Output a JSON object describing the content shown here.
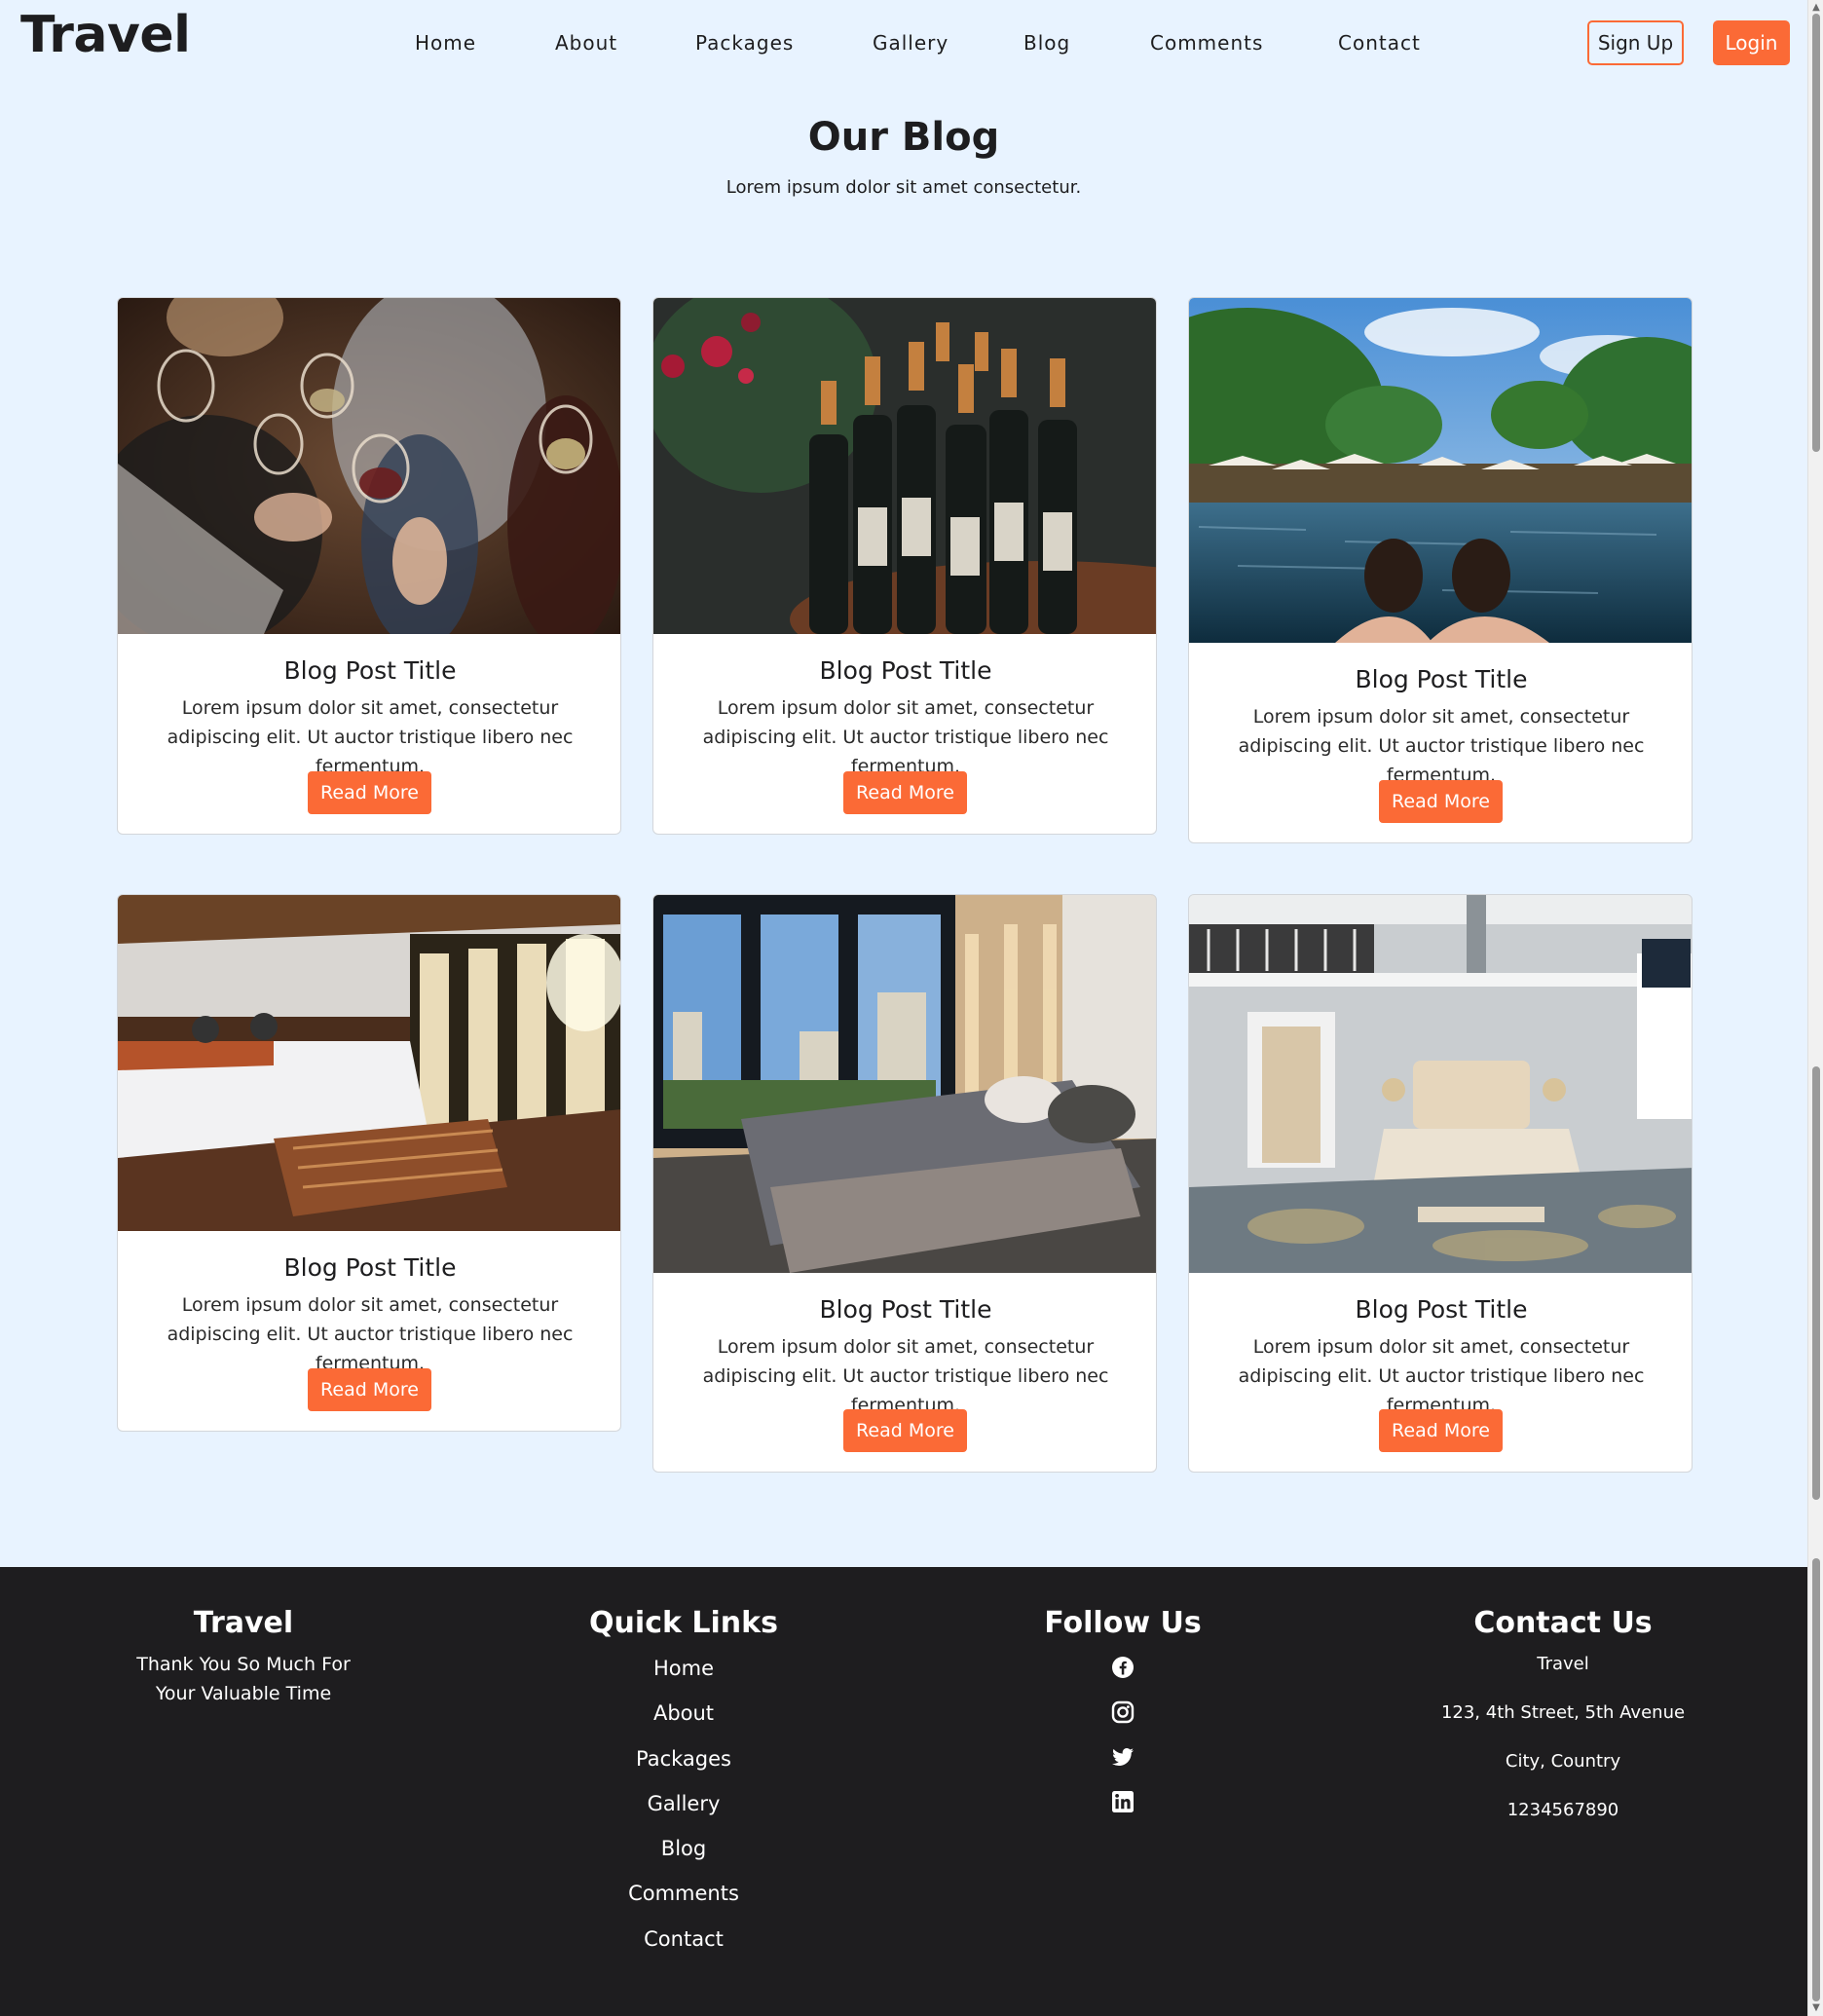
{
  "nav": {
    "brand": "Travel",
    "links": [
      "Home",
      "About",
      "Packages",
      "Gallery",
      "Blog",
      "Comments",
      "Contact"
    ],
    "signup": "Sign Up",
    "login": "Login"
  },
  "blog": {
    "title": "Our Blog",
    "subtitle": "Lorem ipsum dolor sit amet consectetur.",
    "posts": [
      {
        "title": "Blog Post Title",
        "text": "Lorem ipsum dolor sit amet, consectetur adipiscing elit. Ut auctor tristique libero nec fermentum.",
        "button": "Read More",
        "image": "people-toasting-wine-photo"
      },
      {
        "title": "Blog Post Title",
        "text": "Lorem ipsum dolor sit amet, consectetur adipiscing elit. Ut auctor tristique libero nec fermentum.",
        "button": "Read More",
        "image": "wine-bottles-flowers-photo"
      },
      {
        "title": "Blog Post Title",
        "text": "Lorem ipsum dolor sit amet, consectetur adipiscing elit. Ut auctor tristique libero nec fermentum.",
        "button": "Read More",
        "image": "infinity-pool-palms-photo"
      },
      {
        "title": "Blog Post Title",
        "text": "Lorem ipsum dolor sit amet, consectetur adipiscing elit. Ut auctor tristique libero nec fermentum.",
        "button": "Read More",
        "image": "sunny-bedroom-photo"
      },
      {
        "title": "Blog Post Title",
        "text": "Lorem ipsum dolor sit amet, consectetur adipiscing elit. Ut auctor tristique libero nec fermentum.",
        "button": "Read More",
        "image": "city-view-bedroom-photo"
      },
      {
        "title": "Blog Post Title",
        "text": "Lorem ipsum dolor sit amet, consectetur adipiscing elit. Ut auctor tristique libero nec fermentum.",
        "button": "Read More",
        "image": "loft-bedroom-photo"
      }
    ]
  },
  "footer": {
    "brand": {
      "title": "Travel",
      "line1": "Thank You So Much For",
      "line2": "Your Valuable Time"
    },
    "quick_links": {
      "title": "Quick Links",
      "items": [
        "Home",
        "About",
        "Packages",
        "Gallery",
        "Blog",
        "Comments",
        "Contact"
      ]
    },
    "follow": {
      "title": "Follow Us",
      "icons": [
        "facebook-icon",
        "instagram-icon",
        "twitter-icon",
        "linkedin-icon"
      ]
    },
    "contact": {
      "title": "Contact Us",
      "items": [
        "Travel",
        "123, 4th Street, 5th Avenue",
        "City, Country",
        "1234567890"
      ]
    }
  },
  "colors": {
    "accent": "#fb6a36",
    "page_bg": "#e8f3ff",
    "footer_bg": "#1e1d1f"
  }
}
